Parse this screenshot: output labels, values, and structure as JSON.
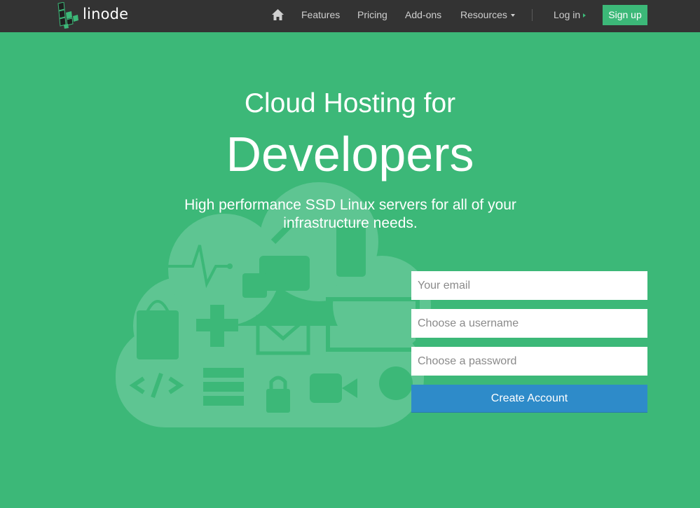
{
  "brand": {
    "name": "linode",
    "accent_color": "#3cb878",
    "nav_color": "#333333"
  },
  "nav": {
    "home_icon": "home-icon",
    "features": "Features",
    "pricing": "Pricing",
    "addons": "Add-ons",
    "resources": "Resources",
    "login": "Log in",
    "signup": "Sign up"
  },
  "hero": {
    "line1": "Cloud Hosting for",
    "line2": "Developers",
    "subtitle": "High performance SSD Linux servers for all of your infrastructure needs."
  },
  "form": {
    "email_placeholder": "Your email",
    "username_placeholder": "Choose a username",
    "password_placeholder": "Choose a password",
    "submit_label": "Create Account",
    "button_color": "#2e8bc9"
  }
}
